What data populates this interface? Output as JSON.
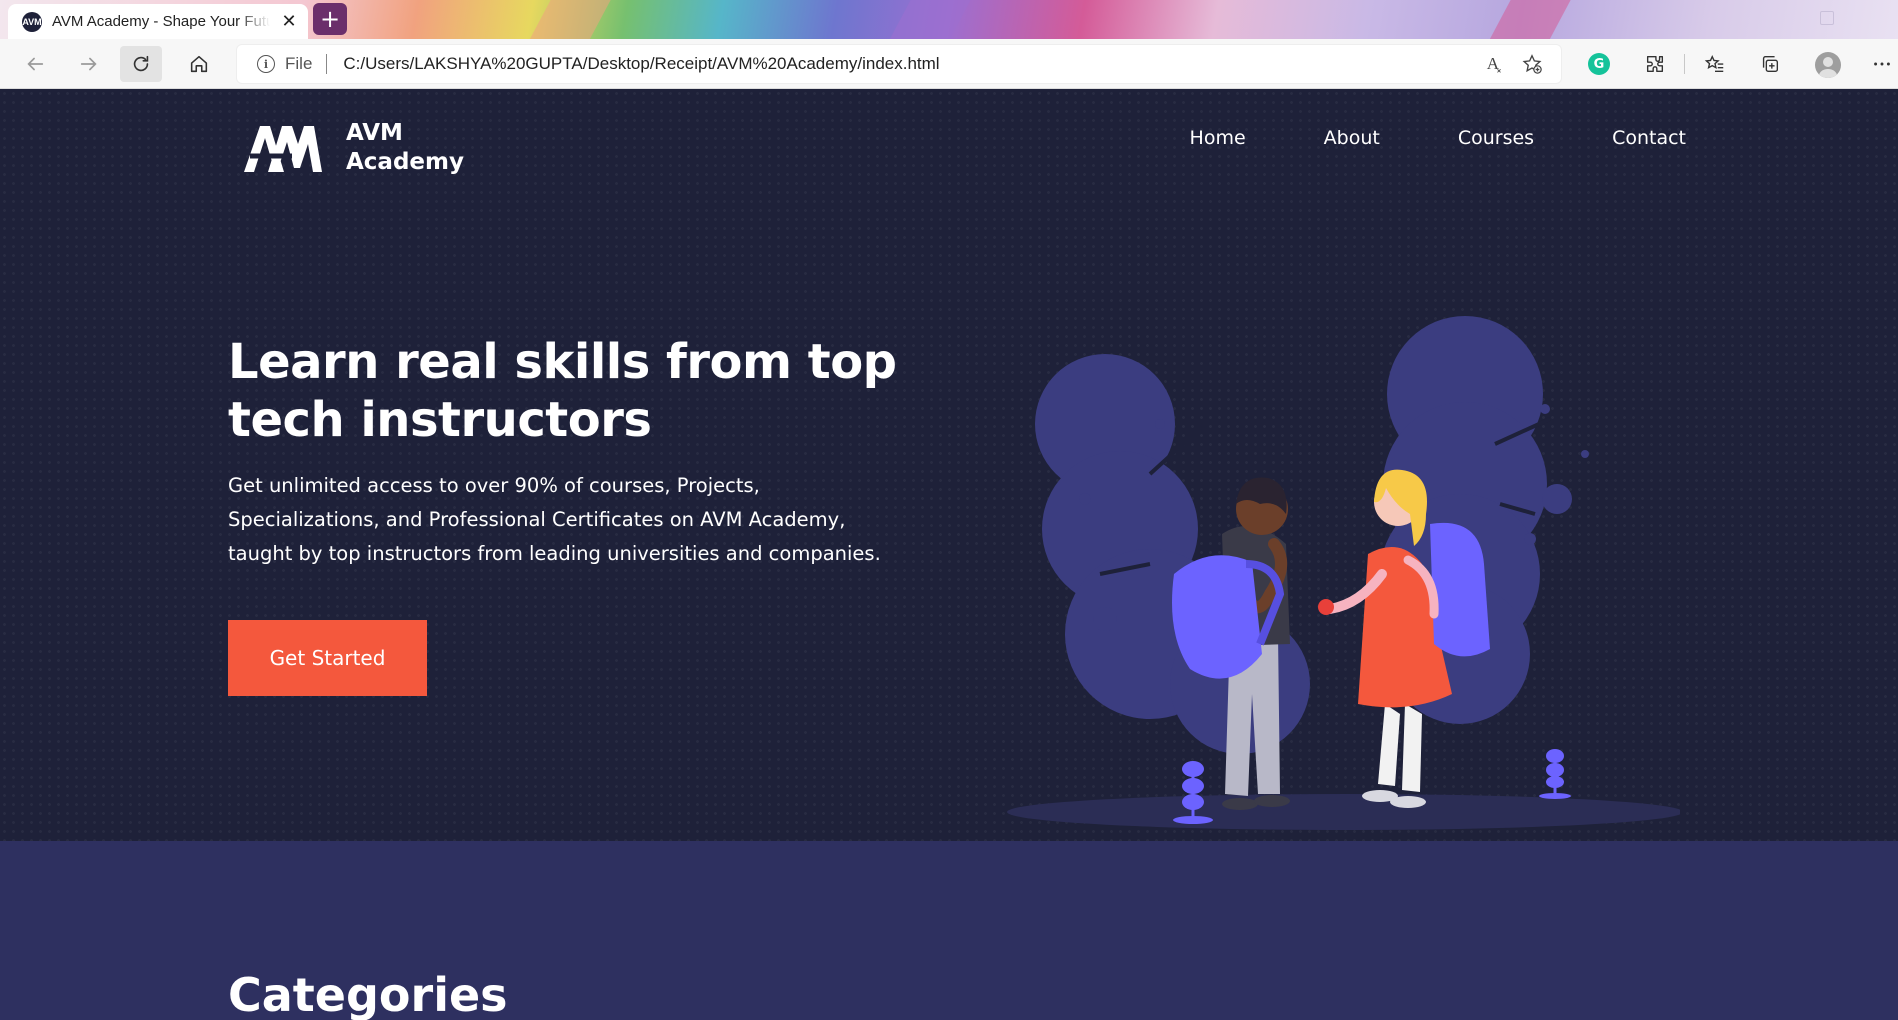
{
  "browser": {
    "tab": {
      "favicon_text": "AVM",
      "title": "AVM Academy - Shape Your Future",
      "close_glyph": "✕"
    },
    "new_tab_glyph": "+",
    "address_bar": {
      "site_info_label": "File",
      "url": "C:/Users/LAKSHYA%20GUPTA/Desktop/Receipt/AVM%20Academy/index.html"
    },
    "toolbar_icons": [
      "back-icon",
      "forward-icon",
      "refresh-icon",
      "home-icon",
      "read-aloud-icon",
      "add-favorite-icon",
      "grammarly-icon",
      "extensions-icon",
      "favorites-icon",
      "collections-icon",
      "profile-icon",
      "more-icon"
    ],
    "grammarly_letter": "G",
    "read_aloud_glyph": "A͓"
  },
  "site": {
    "brand": {
      "logo_text": "AVM",
      "name_line1": "AVM",
      "name_line2": "Academy"
    },
    "nav": [
      "Home",
      "About",
      "Courses",
      "Contact"
    ],
    "hero": {
      "title_line1": "Learn real skills from top",
      "title_line2": "tech instructors",
      "description_line1": "Get unlimited access to over 90% of courses, Projects,",
      "description_line2": "Specializations, and Professional Certificates on AVM Academy,",
      "description_line3": "taught by top instructors from leading universities and companies.",
      "cta_label": "Get Started"
    },
    "categories": {
      "title": "Categories"
    }
  },
  "colors": {
    "hero_bg": "#1e2139",
    "section_bg": "#2e3060",
    "accent": "#f4583d",
    "illustration_blob": "#3b3d80",
    "illustration_purple": "#6c63ff"
  }
}
